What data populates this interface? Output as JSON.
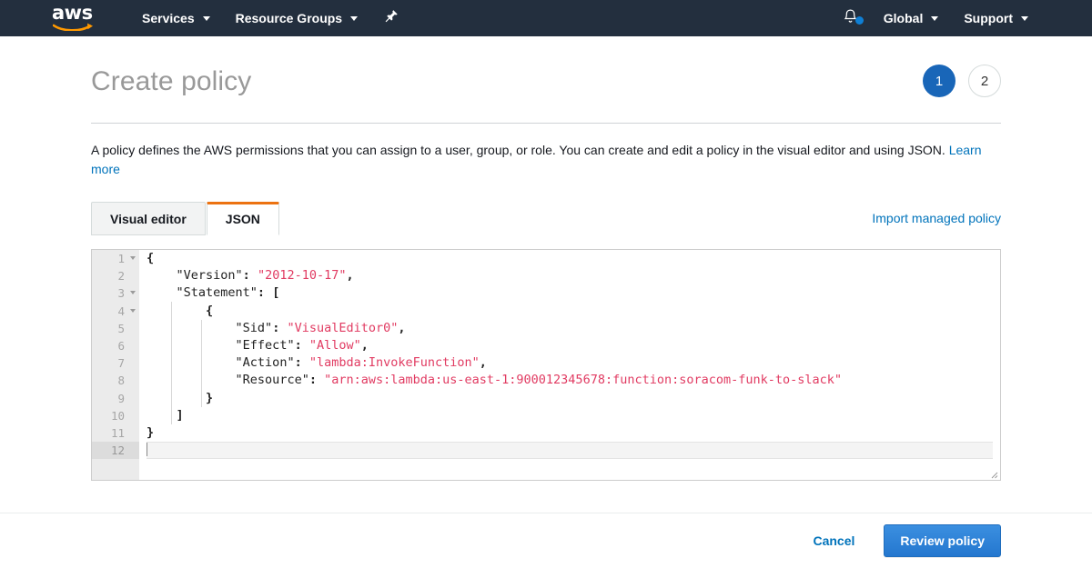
{
  "navbar": {
    "logo_text": "aws",
    "items": [
      {
        "label": "Services",
        "icon": "chevron-down-icon"
      },
      {
        "label": "Resource Groups",
        "icon": "chevron-down-icon"
      }
    ],
    "pin_icon": "pushpin-icon",
    "bell_icon": "bell-icon",
    "notification_dot": true,
    "right_items": [
      {
        "label": "Global",
        "icon": "chevron-down-icon"
      },
      {
        "label": "Support",
        "icon": "chevron-down-icon"
      }
    ],
    "background_color": "#232f3e"
  },
  "header": {
    "title": "Create policy",
    "steps": [
      {
        "number": "1",
        "state": "active"
      },
      {
        "number": "2",
        "state": "inactive"
      }
    ],
    "active_step_color": "#1966b8"
  },
  "description": {
    "text": "A policy defines the AWS permissions that you can assign to a user, group, or role. You can create and edit a policy in the visual editor and using JSON. ",
    "link_label": "Learn more",
    "link_color": "#0073bb"
  },
  "tabs": {
    "items": [
      {
        "label": "Visual editor",
        "active": false
      },
      {
        "label": "JSON",
        "active": true
      }
    ],
    "active_indicator_color": "#ec7211",
    "import_link_label": "Import managed policy"
  },
  "editor": {
    "current_line": 12,
    "total_lines": 12,
    "fold_lines": [
      1,
      3,
      4
    ],
    "string_color": "#e13b62",
    "lines": [
      {
        "n": "1",
        "indent": 0,
        "segments": [
          {
            "t": "{",
            "c": "punc"
          }
        ]
      },
      {
        "n": "2",
        "indent": 1,
        "segments": [
          {
            "t": "\"Version\"",
            "c": "key"
          },
          {
            "t": ": ",
            "c": "punc"
          },
          {
            "t": "\"2012-10-17\"",
            "c": "str"
          },
          {
            "t": ",",
            "c": "punc"
          }
        ]
      },
      {
        "n": "3",
        "indent": 1,
        "segments": [
          {
            "t": "\"Statement\"",
            "c": "key"
          },
          {
            "t": ": ",
            "c": "punc"
          },
          {
            "t": "[",
            "c": "punc"
          }
        ]
      },
      {
        "n": "4",
        "indent": 2,
        "segments": [
          {
            "t": "{",
            "c": "punc"
          }
        ]
      },
      {
        "n": "5",
        "indent": 3,
        "segments": [
          {
            "t": "\"Sid\"",
            "c": "key"
          },
          {
            "t": ": ",
            "c": "punc"
          },
          {
            "t": "\"VisualEditor0\"",
            "c": "str"
          },
          {
            "t": ",",
            "c": "punc"
          }
        ]
      },
      {
        "n": "6",
        "indent": 3,
        "segments": [
          {
            "t": "\"Effect\"",
            "c": "key"
          },
          {
            "t": ": ",
            "c": "punc"
          },
          {
            "t": "\"Allow\"",
            "c": "str"
          },
          {
            "t": ",",
            "c": "punc"
          }
        ]
      },
      {
        "n": "7",
        "indent": 3,
        "segments": [
          {
            "t": "\"Action\"",
            "c": "key"
          },
          {
            "t": ": ",
            "c": "punc"
          },
          {
            "t": "\"lambda:InvokeFunction\"",
            "c": "str"
          },
          {
            "t": ",",
            "c": "punc"
          }
        ]
      },
      {
        "n": "8",
        "indent": 3,
        "segments": [
          {
            "t": "\"Resource\"",
            "c": "key"
          },
          {
            "t": ": ",
            "c": "punc"
          },
          {
            "t": "\"arn:aws:lambda:us-east-1:900012345678:function:soracom-funk-to-slack\"",
            "c": "str"
          }
        ]
      },
      {
        "n": "9",
        "indent": 2,
        "segments": [
          {
            "t": "}",
            "c": "punc"
          }
        ]
      },
      {
        "n": "10",
        "indent": 1,
        "segments": [
          {
            "t": "]",
            "c": "punc"
          }
        ]
      },
      {
        "n": "11",
        "indent": 0,
        "segments": [
          {
            "t": "}",
            "c": "punc"
          }
        ]
      },
      {
        "n": "12",
        "indent": 0,
        "segments": []
      }
    ]
  },
  "footer": {
    "cancel_label": "Cancel",
    "review_label": "Review policy",
    "primary_color": "#2477cf"
  }
}
